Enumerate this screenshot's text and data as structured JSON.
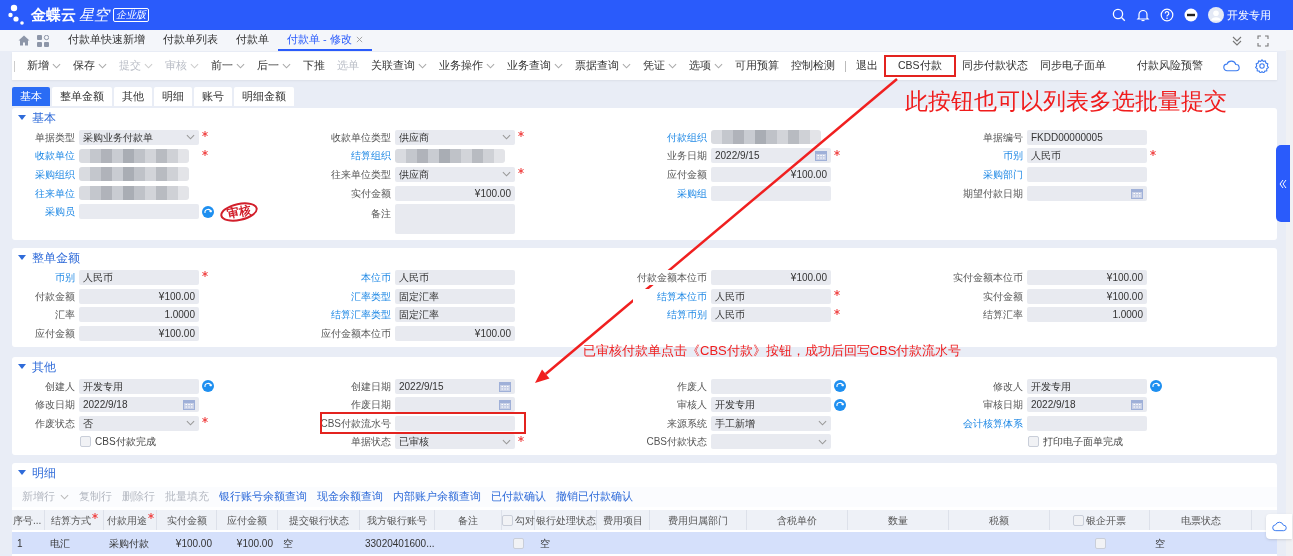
{
  "header": {
    "brand": "金蝶云",
    "product": "星空",
    "edition": "企业版",
    "user": "开发专用"
  },
  "page_tabs": [
    {
      "label": "付款单快速新增",
      "selected": false,
      "closable": false
    },
    {
      "label": "付款单列表",
      "selected": false,
      "closable": false
    },
    {
      "label": "付款单",
      "selected": false,
      "closable": false
    },
    {
      "label": "付款单 - 修改",
      "selected": true,
      "closable": true
    }
  ],
  "toolbar": {
    "items": [
      {
        "label": "新增",
        "dropdown": true,
        "disabled": false
      },
      {
        "label": "保存",
        "dropdown": true,
        "disabled": false
      },
      {
        "label": "提交",
        "dropdown": true,
        "disabled": true
      },
      {
        "label": "审核",
        "dropdown": true,
        "disabled": true
      },
      {
        "label": "前一",
        "dropdown": true,
        "disabled": false
      },
      {
        "label": "后一",
        "dropdown": true,
        "disabled": false
      },
      {
        "label": "下推",
        "dropdown": false,
        "disabled": false
      },
      {
        "label": "选单",
        "dropdown": false,
        "disabled": true
      },
      {
        "label": "关联查询",
        "dropdown": true,
        "disabled": false
      },
      {
        "label": "业务操作",
        "dropdown": true,
        "disabled": false
      },
      {
        "label": "业务查询",
        "dropdown": true,
        "disabled": false
      },
      {
        "label": "票据查询",
        "dropdown": true,
        "disabled": false
      },
      {
        "label": "凭证",
        "dropdown": true,
        "disabled": false
      },
      {
        "label": "选项",
        "dropdown": true,
        "disabled": false
      },
      {
        "label": "可用预算",
        "dropdown": false,
        "disabled": false
      },
      {
        "label": "控制检测",
        "dropdown": false,
        "disabled": false
      },
      {
        "label": "退出",
        "dropdown": false,
        "disabled": false,
        "divider_before": true
      },
      {
        "label": "CBS付款",
        "dropdown": false,
        "disabled": false,
        "highlighted": true
      },
      {
        "label": "同步付款状态",
        "dropdown": false,
        "disabled": false
      },
      {
        "label": "同步电子面单",
        "dropdown": false,
        "disabled": false
      }
    ],
    "right_label": "付款风险预警"
  },
  "form_tabs": [
    {
      "label": "基本",
      "selected": true
    },
    {
      "label": "整单金额",
      "selected": false
    },
    {
      "label": "其他",
      "selected": false
    },
    {
      "label": "明细",
      "selected": false
    },
    {
      "label": "账号",
      "selected": false
    },
    {
      "label": "明细金额",
      "selected": false
    }
  ],
  "sections": [
    {
      "title": "基本",
      "expanded": true,
      "columns": [
        [
          {
            "label": "单据类型",
            "kind": "select",
            "value": "采购业务付款单",
            "required": true
          },
          {
            "label": "收款单位",
            "kind": "text",
            "link": true,
            "redacted": true,
            "required": true
          },
          {
            "label": "采购组织",
            "kind": "text",
            "link": true,
            "redacted": true
          },
          {
            "label": "往来单位",
            "kind": "text",
            "link": true,
            "redacted": true
          },
          {
            "label": "采购员",
            "kind": "text",
            "link": true,
            "lookup": true,
            "stamp": "审核"
          }
        ],
        [
          {
            "label": "收款单位类型",
            "kind": "select",
            "value": "供应商",
            "required": true
          },
          {
            "label": "结算组织",
            "kind": "text",
            "link": true,
            "redacted": true
          },
          {
            "label": "往来单位类型",
            "kind": "select",
            "value": "供应商",
            "required": true
          },
          {
            "label": "实付金额",
            "kind": "amount",
            "value": "¥100.00"
          },
          {
            "label": "备注",
            "kind": "memo"
          }
        ],
        [
          {
            "label": "付款组织",
            "kind": "text",
            "link": true,
            "redacted": true
          },
          {
            "label": "业务日期",
            "kind": "date",
            "value": "2022/9/15",
            "required": true
          },
          {
            "label": "应付金额",
            "kind": "amount",
            "value": "¥100.00"
          },
          {
            "label": "采购组",
            "kind": "text",
            "link": true
          }
        ],
        [
          {
            "label": "单据编号",
            "kind": "text",
            "value": "FKDD00000005"
          },
          {
            "label": "币别",
            "kind": "text",
            "link": true,
            "value": "人民币",
            "required": true
          },
          {
            "label": "采购部门",
            "kind": "text",
            "link": true
          },
          {
            "label": "期望付款日期",
            "kind": "date"
          }
        ]
      ]
    },
    {
      "title": "整单金额",
      "expanded": true,
      "columns": [
        [
          {
            "label": "币别",
            "kind": "text",
            "link": true,
            "value": "人民币",
            "required": true
          },
          {
            "label": "付款金额",
            "kind": "amount",
            "value": "¥100.00"
          },
          {
            "label": "汇率",
            "kind": "amount",
            "value": "1.0000"
          },
          {
            "label": "应付金额",
            "kind": "amount",
            "value": "¥100.00"
          }
        ],
        [
          {
            "label": "本位币",
            "kind": "text",
            "link": true,
            "value": "人民币"
          },
          {
            "label": "汇率类型",
            "kind": "text",
            "link": true,
            "value": "固定汇率"
          },
          {
            "label": "结算汇率类型",
            "kind": "text",
            "link": true,
            "value": "固定汇率"
          },
          {
            "label": "应付金额本位币",
            "kind": "amount",
            "value": "¥100.00"
          }
        ],
        [
          {
            "label": "付款金额本位币",
            "kind": "amount",
            "value": "¥100.00"
          },
          {
            "label": "结算本位币",
            "kind": "text",
            "link": true,
            "value": "人民币",
            "required": true
          },
          {
            "label": "结算币别",
            "kind": "text",
            "link": true,
            "value": "人民币",
            "required": true
          }
        ],
        [
          {
            "label": "实付金额本位币",
            "kind": "amount",
            "value": "¥100.00"
          },
          {
            "label": "实付金额",
            "kind": "amount",
            "value": "¥100.00"
          },
          {
            "label": "结算汇率",
            "kind": "amount",
            "value": "1.0000"
          }
        ]
      ]
    },
    {
      "title": "其他",
      "expanded": true,
      "columns": [
        [
          {
            "label": "创建人",
            "kind": "text",
            "value": "开发专用",
            "lookup": true
          },
          {
            "label": "修改日期",
            "kind": "date",
            "value": "2022/9/18"
          },
          {
            "label": "作废状态",
            "kind": "select",
            "value": "否",
            "required": true
          },
          {
            "label": "CBS付款完成",
            "kind": "checkbox",
            "checked": false
          }
        ],
        [
          {
            "label": "创建日期",
            "kind": "date",
            "value": "2022/9/15"
          },
          {
            "label": "作废日期",
            "kind": "date"
          },
          {
            "label": "CBS付款流水号",
            "kind": "text",
            "highlighted": true
          },
          {
            "label": "单据状态",
            "kind": "select",
            "value": "已审核",
            "required": true
          }
        ],
        [
          {
            "label": "作废人",
            "kind": "text",
            "lookup": true
          },
          {
            "label": "审核人",
            "kind": "text",
            "value": "开发专用",
            "lookup": true
          },
          {
            "label": "来源系统",
            "kind": "select",
            "value": "手工新增"
          },
          {
            "label": "CBS付款状态",
            "kind": "select"
          }
        ],
        [
          {
            "label": "修改人",
            "kind": "text",
            "value": "开发专用",
            "lookup": true
          },
          {
            "label": "审核日期",
            "kind": "date",
            "value": "2022/9/18"
          },
          {
            "label": "会计核算体系",
            "kind": "text",
            "link": true
          },
          {
            "label": "打印电子面单完成",
            "kind": "checkbox",
            "checked": false
          }
        ]
      ]
    }
  ],
  "detail": {
    "title": "明细",
    "expanded": true,
    "actions": [
      {
        "label": "新增行",
        "dropdown": true,
        "disabled": true
      },
      {
        "label": "复制行",
        "disabled": true
      },
      {
        "label": "删除行",
        "disabled": true
      },
      {
        "label": "批量填充",
        "disabled": true
      },
      {
        "label": "银行账号余额查询",
        "disabled": false
      },
      {
        "label": "现金余额查询",
        "disabled": false
      },
      {
        "label": "内部账户余额查询",
        "disabled": false
      },
      {
        "label": "已付款确认",
        "disabled": false
      },
      {
        "label": "撤销已付款确认",
        "disabled": false
      }
    ],
    "table": {
      "columns": [
        {
          "label": "序号...",
          "kind": "text"
        },
        {
          "label": "结算方式",
          "kind": "text",
          "required": true
        },
        {
          "label": "付款用途",
          "kind": "text",
          "required": true
        },
        {
          "label": "实付金额",
          "kind": "amount"
        },
        {
          "label": "应付金额",
          "kind": "amount"
        },
        {
          "label": "提交银行状态",
          "kind": "text"
        },
        {
          "label": "我方银行账号",
          "kind": "text"
        },
        {
          "label": "备注",
          "kind": "text"
        },
        {
          "label": "勾对",
          "kind": "checkbox",
          "checked": false
        },
        {
          "label": "银行处理状态",
          "kind": "text"
        },
        {
          "label": "费用项目",
          "kind": "text"
        },
        {
          "label": "费用归属部门",
          "kind": "text"
        },
        {
          "label": "含税单价",
          "kind": "text"
        },
        {
          "label": "数量",
          "kind": "text"
        },
        {
          "label": "税额",
          "kind": "text"
        },
        {
          "label": "银企开票",
          "kind": "checkbox",
          "checked": false
        },
        {
          "label": "电票状态",
          "kind": "text"
        }
      ],
      "rows": [
        {
          "selected": true,
          "cells": [
            {
              "text": "1"
            },
            {
              "text": "电汇"
            },
            {
              "text": "采购付款"
            },
            {
              "text": "¥100.00"
            },
            {
              "text": "¥100.00"
            },
            {
              "text": "空"
            },
            {
              "text": "33020401600..."
            },
            {},
            {
              "checked": false
            },
            {
              "text": "空"
            },
            {},
            {},
            {},
            {},
            {},
            {
              "checked": false
            },
            {
              "text": "空"
            }
          ]
        }
      ]
    }
  },
  "annotations": [
    {
      "text": "此按钮也可以列表多选批量提交"
    },
    {
      "text": "已审核付款单点击《CBS付款》按钮，成功后回写CBS付款流水号"
    }
  ]
}
